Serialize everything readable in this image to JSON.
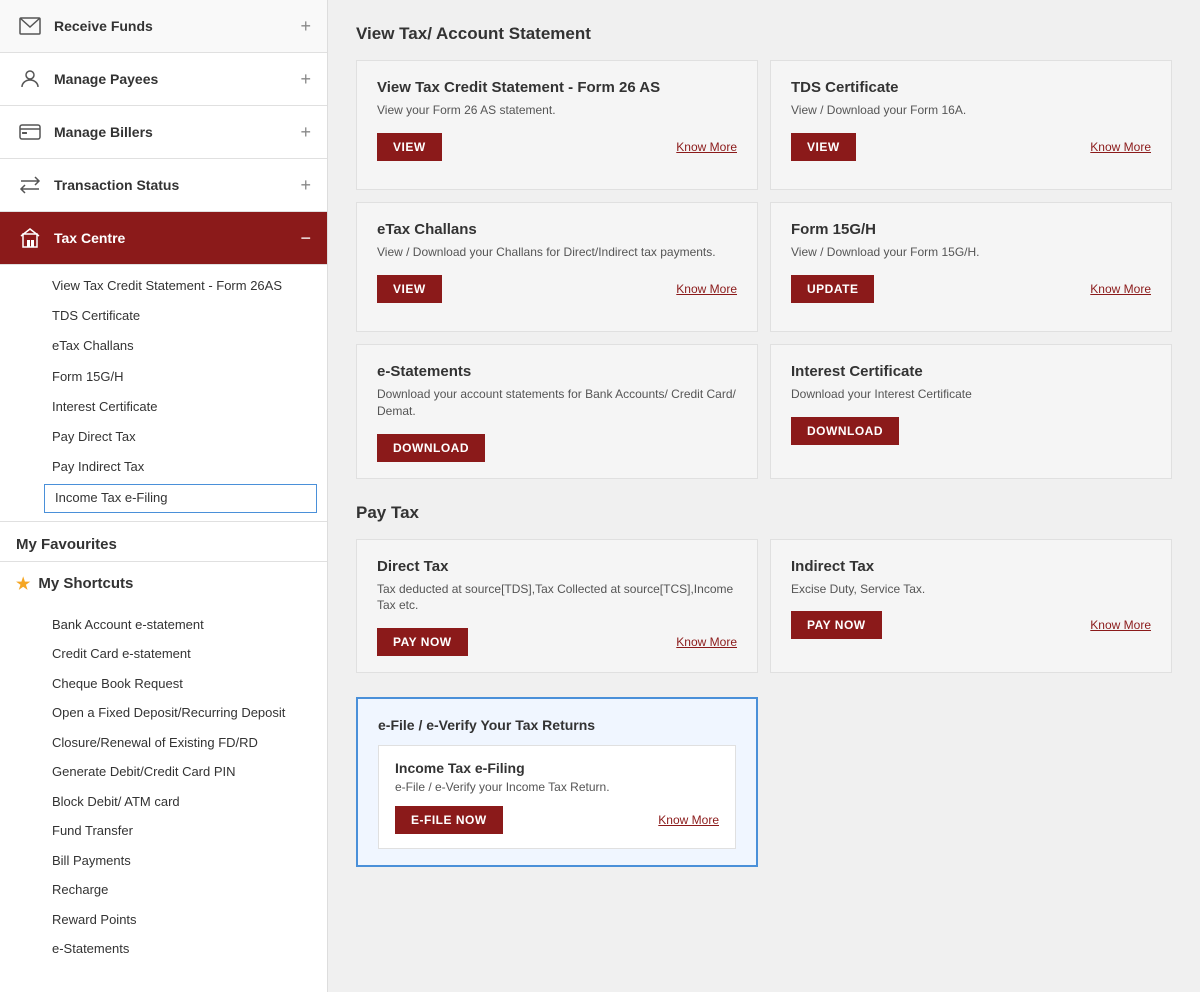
{
  "sidebar": {
    "nav_items": [
      {
        "id": "receive-funds",
        "label": "Receive Funds",
        "icon": "envelope",
        "has_toggle": true,
        "active": false
      },
      {
        "id": "manage-payees",
        "label": "Manage Payees",
        "icon": "person",
        "has_toggle": true,
        "active": false
      },
      {
        "id": "manage-billers",
        "label": "Manage Billers",
        "icon": "credit-card",
        "has_toggle": true,
        "active": false
      },
      {
        "id": "transaction-status",
        "label": "Transaction Status",
        "icon": "arrows",
        "has_toggle": true,
        "active": false
      },
      {
        "id": "tax-centre",
        "label": "Tax Centre",
        "icon": "building",
        "has_toggle": true,
        "active": true
      }
    ],
    "tax_centre_submenu": [
      {
        "id": "view-tax-credit",
        "label": "View Tax Credit Statement - Form 26AS",
        "selected": false
      },
      {
        "id": "tds-certificate",
        "label": "TDS Certificate",
        "selected": false
      },
      {
        "id": "etax-challans",
        "label": "eTax Challans",
        "selected": false
      },
      {
        "id": "form-15gh",
        "label": "Form 15G/H",
        "selected": false
      },
      {
        "id": "interest-certificate",
        "label": "Interest Certificate",
        "selected": false
      },
      {
        "id": "pay-direct-tax",
        "label": "Pay Direct Tax",
        "selected": false
      },
      {
        "id": "pay-indirect-tax",
        "label": "Pay Indirect Tax",
        "selected": false
      },
      {
        "id": "income-tax-efiling",
        "label": "Income Tax e-Filing",
        "selected": true
      }
    ],
    "my_favourites_label": "My Favourites",
    "my_shortcuts_label": "My Shortcuts",
    "shortcuts": [
      {
        "id": "bank-account-estatement",
        "label": "Bank Account e-statement"
      },
      {
        "id": "credit-card-estatement",
        "label": "Credit Card e-statement"
      },
      {
        "id": "cheque-book-request",
        "label": "Cheque Book Request"
      },
      {
        "id": "open-fixed-deposit",
        "label": "Open a Fixed Deposit/Recurring Deposit"
      },
      {
        "id": "closure-renewal",
        "label": "Closure/Renewal of Existing FD/RD"
      },
      {
        "id": "generate-pin",
        "label": "Generate Debit/Credit Card PIN"
      },
      {
        "id": "block-card",
        "label": "Block Debit/ ATM card"
      },
      {
        "id": "fund-transfer",
        "label": "Fund Transfer"
      },
      {
        "id": "bill-payments",
        "label": "Bill Payments"
      },
      {
        "id": "recharge",
        "label": "Recharge"
      },
      {
        "id": "reward-points",
        "label": "Reward Points"
      },
      {
        "id": "e-statements",
        "label": "e-Statements"
      }
    ]
  },
  "main": {
    "view_tax_section_title": "View Tax/ Account Statement",
    "cards": [
      {
        "id": "view-tax-credit",
        "title": "View Tax Credit Statement - Form 26 AS",
        "desc": "View your Form 26 AS statement.",
        "btn_label": "VIEW",
        "know_more": "Know More",
        "highlighted": false
      },
      {
        "id": "tds-certificate",
        "title": "TDS Certificate",
        "desc": "View / Download your Form 16A.",
        "btn_label": "VIEW",
        "know_more": "Know More",
        "highlighted": false
      },
      {
        "id": "etax-challans",
        "title": "eTax Challans",
        "desc": "View / Download your Challans for Direct/Indirect tax payments.",
        "btn_label": "VIEW",
        "know_more": "Know More",
        "highlighted": false
      },
      {
        "id": "form-15gh",
        "title": "Form 15G/H",
        "desc": "View / Download your Form 15G/H.",
        "btn_label": "UPDATE",
        "know_more": "Know More",
        "highlighted": false
      },
      {
        "id": "e-statements",
        "title": "e-Statements",
        "desc": "Download your account statements for Bank Accounts/ Credit Card/ Demat.",
        "btn_label": "DOWNLOAD",
        "know_more": null,
        "highlighted": false
      },
      {
        "id": "interest-certificate",
        "title": "Interest Certificate",
        "desc": "Download your Interest Certificate",
        "btn_label": "DOWNLOAD",
        "know_more": null,
        "highlighted": false
      }
    ],
    "pay_tax_title": "Pay Tax",
    "pay_tax_cards": [
      {
        "id": "direct-tax",
        "title": "Direct Tax",
        "desc": "Tax deducted at source[TDS],Tax Collected at source[TCS],Income Tax etc.",
        "btn_label": "PAY NOW",
        "know_more": "Know More",
        "highlighted": false
      },
      {
        "id": "indirect-tax",
        "title": "Indirect Tax",
        "desc": "Excise Duty, Service Tax.",
        "btn_label": "PAY NOW",
        "know_more": "Know More",
        "highlighted": false
      }
    ],
    "efile_section_title": "e-File / e-Verify Your Tax Returns",
    "efile_card": {
      "id": "income-tax-efiling",
      "title": "Income Tax e-Filing",
      "desc": "e-File / e-Verify your Income Tax Return.",
      "btn_label": "E-FILE NOW",
      "know_more": "Know More",
      "highlighted": true
    }
  }
}
